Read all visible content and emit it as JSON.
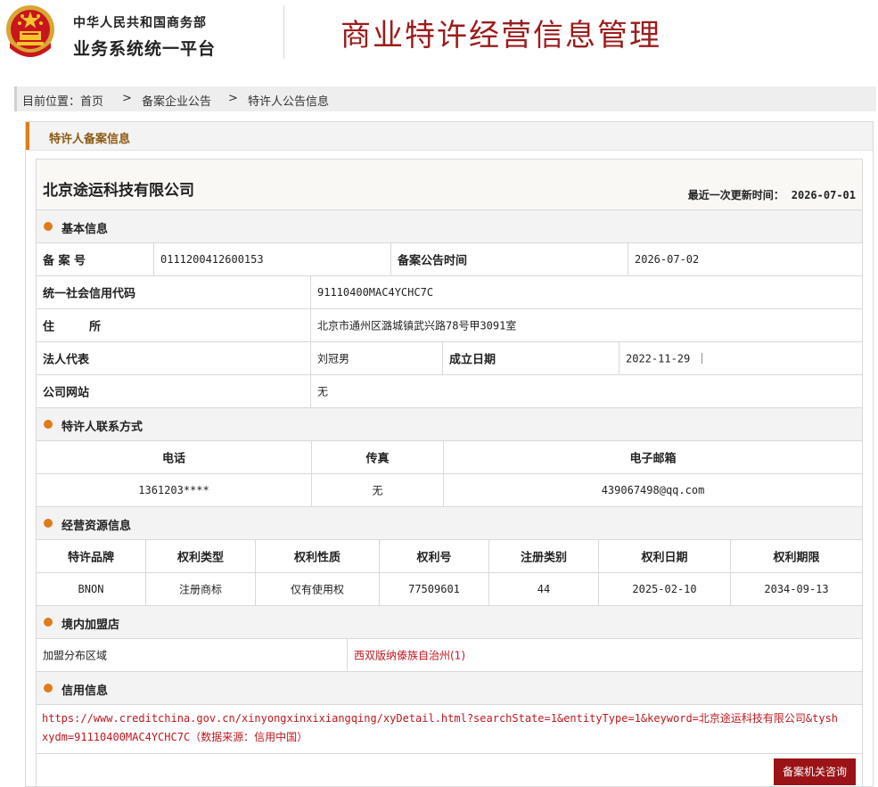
{
  "header": {
    "org_line1": "中华人民共和国商务部",
    "org_line2": "业务系统统一平台",
    "system_title": "商业特许经营信息管理"
  },
  "breadcrumb": {
    "prefix": "目前位置：首页",
    "sep": ">",
    "item2": "备案企业公告",
    "item3": "特许人公告信息"
  },
  "panel": {
    "title": "特许人备案信息"
  },
  "company": {
    "name": "北京途运科技有限公司",
    "updated_label": "最近一次更新时间：",
    "updated_value": "2026-07-01"
  },
  "basic": {
    "title": "基本信息",
    "filing_no_label": "备 案 号",
    "filing_no": "0111200412600153",
    "announce_time_label": "备案公告时间",
    "announce_time": "2026-07-02",
    "credit_code_label": "统一社会信用代码",
    "credit_code": "91110400MAC4YCHC7C",
    "address_label": "住　　　所",
    "address": "北京市通州区潞城镇武兴路78号甲3091室",
    "legal_rep_label": "法人代表",
    "legal_rep": "刘冠男",
    "founded_label": "成立日期",
    "founded": "2022-11-29 ｜",
    "website_label": "公司网站",
    "website": "无"
  },
  "contact": {
    "title": "特许人联系方式",
    "headers": [
      "电话",
      "传真",
      "电子邮箱"
    ],
    "values": [
      "1361203****",
      "无",
      "439067498@qq.com"
    ]
  },
  "resources": {
    "title": "经营资源信息",
    "headers": [
      "特许品牌",
      "权利类型",
      "权利性质",
      "权利号",
      "注册类别",
      "权利日期",
      "权利期限"
    ],
    "values": [
      "BNON",
      "注册商标",
      "仅有使用权",
      "77509601",
      "44",
      "2025-02-10",
      "2034-09-13"
    ]
  },
  "stores": {
    "title": "境内加盟店",
    "region_label": "加盟分布区域",
    "region_value": "西双版纳傣族自治州(1)"
  },
  "credit": {
    "title": "信用信息",
    "text": "https://www.creditchina.gov.cn/xinyongxinxixiangqing/xyDetail.html?searchState=1&entityType=1&keyword=北京途运科技有限公司&tyshxydm=91110400MAC4YCHC7C（数据来源：信用中国）"
  },
  "actions": {
    "consult_button": "备案机关咨询"
  },
  "colors": {
    "accent": "#e07b1a",
    "brand_red": "#9b1c1c",
    "link_red": "#c0171e"
  }
}
